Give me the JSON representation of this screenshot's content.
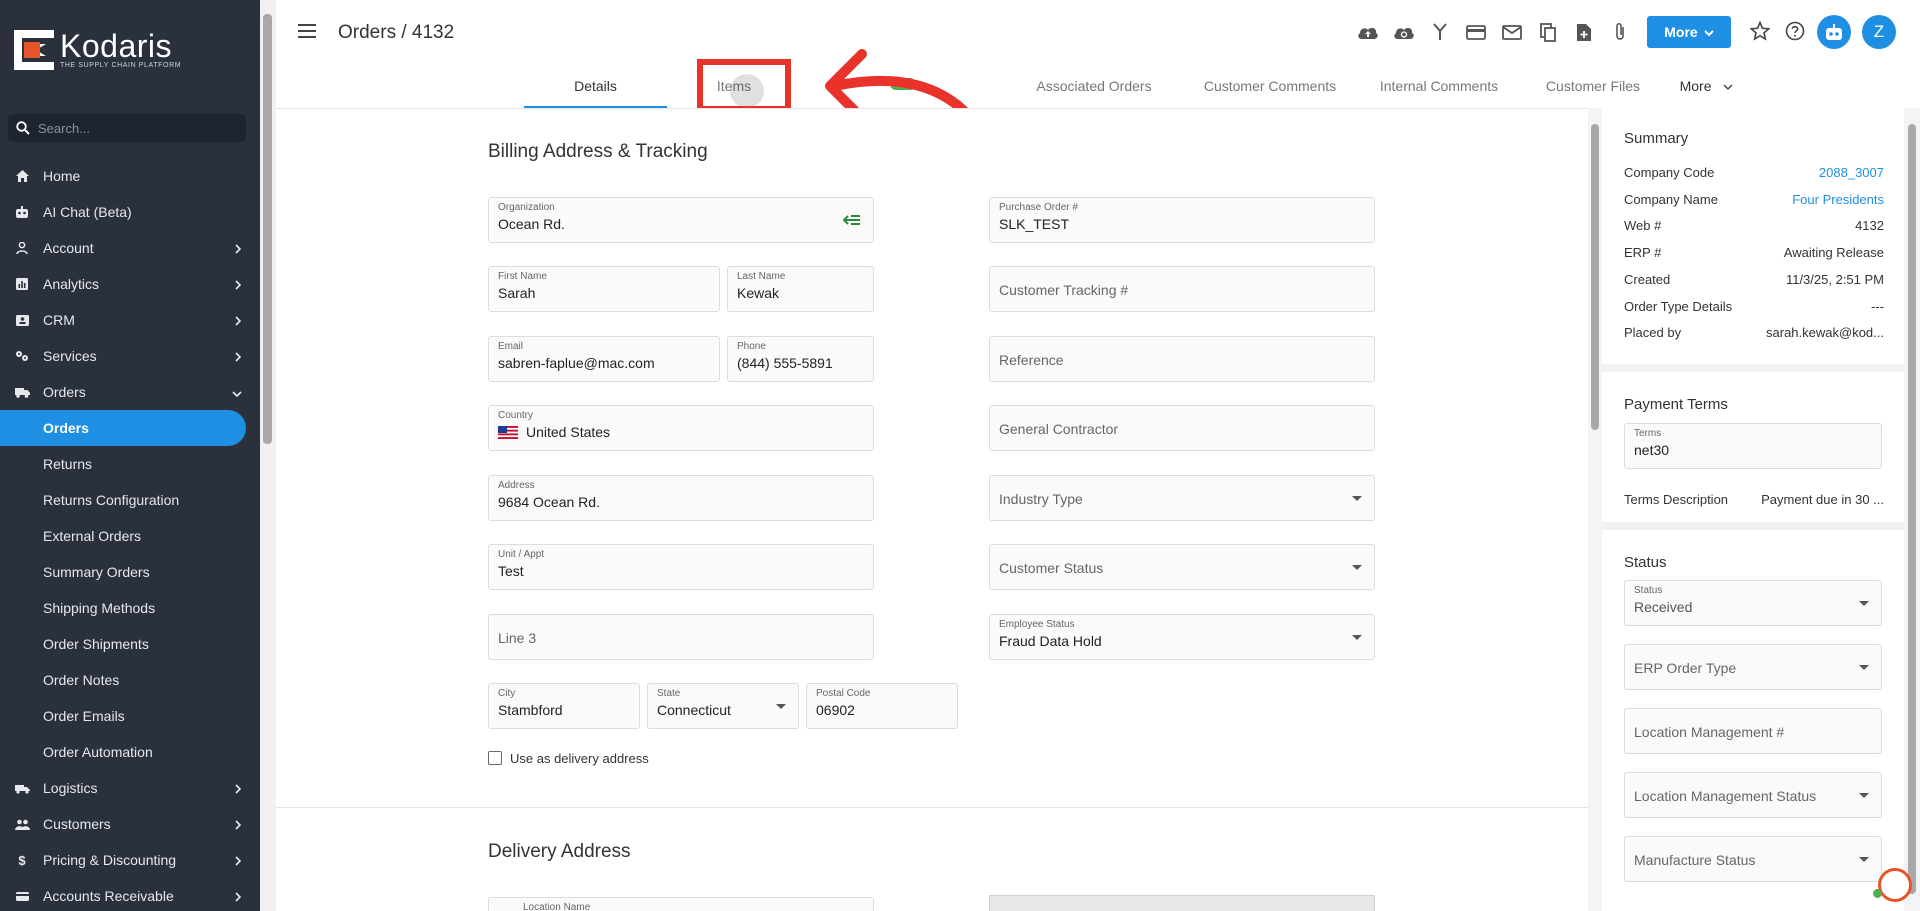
{
  "logo": {
    "name": "Kodaris",
    "tagline": "THE SUPPLY CHAIN PLATFORM"
  },
  "search": {
    "placeholder": "Search..."
  },
  "nav": {
    "items": [
      {
        "label": "Home",
        "icon": "home-icon"
      },
      {
        "label": "AI Chat (Beta)",
        "icon": "robot-icon"
      },
      {
        "label": "Account",
        "icon": "user-icon"
      },
      {
        "label": "Analytics",
        "icon": "chart-icon"
      },
      {
        "label": "CRM",
        "icon": "contact-card-icon"
      },
      {
        "label": "Services",
        "icon": "services-icon"
      },
      {
        "label": "Orders",
        "icon": "truck-icon"
      }
    ],
    "orders_sub": [
      "Orders",
      "Returns",
      "Returns Configuration",
      "External Orders",
      "Summary Orders",
      "Shipping Methods",
      "Order Shipments",
      "Order Notes",
      "Order Emails",
      "Order Automation"
    ],
    "items_after": [
      {
        "label": "Logistics",
        "icon": "logistics-icon"
      },
      {
        "label": "Customers",
        "icon": "customers-icon"
      },
      {
        "label": "Pricing & Discounting",
        "icon": "dollar-icon"
      },
      {
        "label": "Accounts Receivable",
        "icon": "receivable-icon"
      }
    ]
  },
  "header": {
    "breadcrumb": "Orders / 4132",
    "more_button": "More",
    "avatar_initial": "Z"
  },
  "tabs": [
    "Details",
    "Items",
    "Associated Orders",
    "Customer Comments",
    "Internal Comments",
    "Customer Files",
    "More"
  ],
  "billing": {
    "title": "Billing Address & Tracking",
    "organization": {
      "label": "Organization",
      "value": "Ocean Rd."
    },
    "first_name": {
      "label": "First Name",
      "value": "Sarah"
    },
    "last_name": {
      "label": "Last Name",
      "value": "Kewak"
    },
    "email": {
      "label": "Email",
      "value": "sabren-faplue@mac.com"
    },
    "phone": {
      "label": "Phone",
      "value": "(844) 555-5891"
    },
    "country": {
      "label": "Country",
      "value": "United States"
    },
    "address": {
      "label": "Address",
      "value": "9684 Ocean Rd."
    },
    "unit": {
      "label": "Unit / Appt",
      "value": "Test"
    },
    "line3": {
      "placeholder": "Line 3"
    },
    "city": {
      "label": "City",
      "value": "Stambford"
    },
    "state": {
      "label": "State",
      "value": "Connecticut"
    },
    "postal": {
      "label": "Postal Code",
      "value": "06902"
    },
    "use_delivery": "Use as delivery address",
    "po": {
      "label": "Purchase Order #",
      "value": "SLK_TEST"
    },
    "tracking": {
      "placeholder": "Customer Tracking #"
    },
    "reference": {
      "placeholder": "Reference"
    },
    "contractor": {
      "placeholder": "General Contractor"
    },
    "industry": {
      "placeholder": "Industry Type"
    },
    "customer_status": {
      "placeholder": "Customer Status"
    },
    "employee_status": {
      "label": "Employee Status",
      "value": "Fraud Data Hold"
    }
  },
  "delivery": {
    "title": "Delivery Address",
    "location_name": {
      "label": "Location Name"
    }
  },
  "summary": {
    "title": "Summary",
    "rows": [
      {
        "k": "Company Code",
        "v": "2088_3007",
        "link": true
      },
      {
        "k": "Company Name",
        "v": "Four Presidents",
        "link": true
      },
      {
        "k": "Web #",
        "v": "4132",
        "link": false
      },
      {
        "k": "ERP #",
        "v": "Awaiting Release",
        "link": false
      },
      {
        "k": "Created",
        "v": "11/3/25, 2:51 PM",
        "link": false
      },
      {
        "k": "Order Type Details",
        "v": "---",
        "link": false
      },
      {
        "k": "Placed by",
        "v": "sarah.kewak@kod...",
        "link": false
      }
    ]
  },
  "payment": {
    "title": "Payment Terms",
    "terms": {
      "label": "Terms",
      "value": "net30"
    },
    "desc_label": "Terms Description",
    "desc_value": "Payment due in 30 ..."
  },
  "status": {
    "title": "Status",
    "status": {
      "label": "Status",
      "value": "Received"
    },
    "erp_type": {
      "placeholder": "ERP Order Type"
    },
    "loc_mgmt": {
      "placeholder": "Location Management #"
    },
    "loc_mgmt_status": {
      "placeholder": "Location Management Status"
    },
    "manufacture": {
      "placeholder": "Manufacture Status"
    }
  },
  "colors": {
    "sidebar": "#2a313c",
    "accent": "#1e8fe3",
    "highlight": "#e8322a",
    "brand": "#e8542a"
  }
}
